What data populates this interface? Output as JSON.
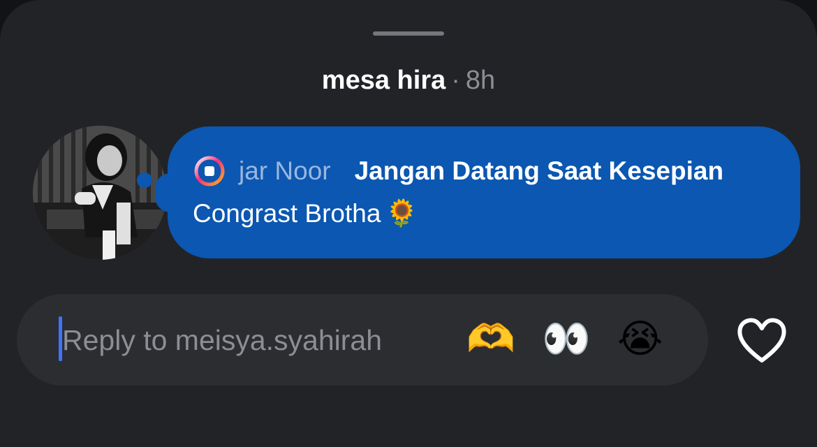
{
  "header": {
    "username": "mesa hira",
    "separator": "·",
    "time": "8h"
  },
  "story_reply": {
    "story_user": "jar Noor",
    "story_title": "Jangan Datang Saat Kesepian",
    "message": "Congrast Brotha",
    "message_emoji": "🌻",
    "story_icon": "story-ring-icon"
  },
  "reply_bar": {
    "placeholder": "Reply to meisya.syahirah",
    "reactions": [
      "🫶",
      "👀",
      "😭"
    ]
  },
  "actions": {
    "like_icon": "heart-outline-icon"
  },
  "colors": {
    "sheet_bg": "#222327",
    "bubble": "#0b57b1",
    "input_bg": "#2b2d31",
    "cursor": "#3f74ff"
  }
}
